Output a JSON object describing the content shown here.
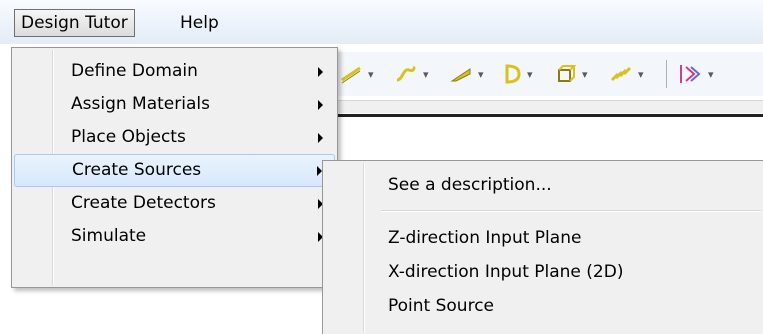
{
  "menubar": {
    "items": [
      {
        "label": "Design Tutor",
        "open": true
      },
      {
        "label": "Help",
        "open": false
      }
    ]
  },
  "toolbar": {
    "buttons": [
      {
        "icon": "line-tool-icon",
        "color": "#d9c21a"
      },
      {
        "icon": "curve-tool-icon",
        "color": "#d9c21a"
      },
      {
        "icon": "wedge-tool-icon",
        "color": "#d9c21a"
      },
      {
        "icon": "d-shape-tool-icon",
        "color": "#d9c21a"
      },
      {
        "icon": "box-tool-icon",
        "color": "#d9c21a"
      },
      {
        "icon": "chain-tool-icon",
        "color": "#d9c21a"
      },
      {
        "icon": "fiber-tool-icon",
        "color": "#d63a8a"
      }
    ]
  },
  "menu": {
    "items": [
      {
        "label": "Define Domain",
        "submenu": true
      },
      {
        "label": "Assign Materials",
        "submenu": true
      },
      {
        "label": "Place Objects",
        "submenu": true
      },
      {
        "label": "Create Sources",
        "submenu": true,
        "highlighted": true
      },
      {
        "label": "Create Detectors",
        "submenu": true
      },
      {
        "label": "Simulate",
        "submenu": true
      }
    ]
  },
  "submenu": {
    "description": "See a description...",
    "items": [
      {
        "label": "Z-direction Input Plane"
      },
      {
        "label": "X-direction Input Plane (2D)"
      },
      {
        "label": "Point Source"
      }
    ]
  },
  "colors": {
    "highlight": "#d7e8fc",
    "menu_background": "#f0f0f0",
    "toolbar_accent": "#d9c21a"
  }
}
